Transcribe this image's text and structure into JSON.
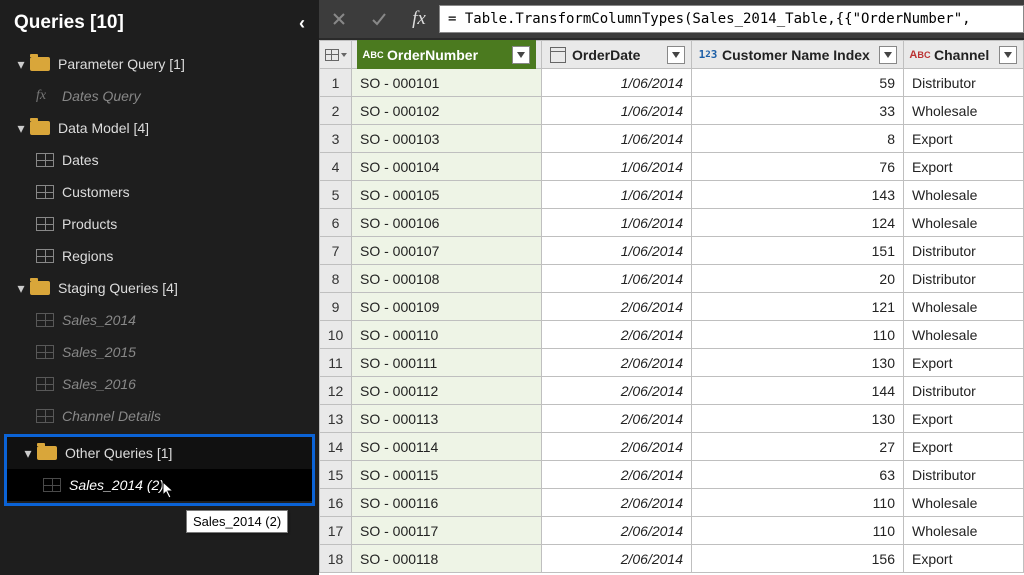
{
  "sidebar": {
    "title": "Queries [10]",
    "groups": [
      {
        "label": "Parameter Query [1]",
        "items": [
          {
            "kind": "fx",
            "label": "Dates Query",
            "dim": true
          }
        ]
      },
      {
        "label": "Data Model [4]",
        "items": [
          {
            "kind": "table",
            "label": "Dates"
          },
          {
            "kind": "table",
            "label": "Customers"
          },
          {
            "kind": "table",
            "label": "Products"
          },
          {
            "kind": "table",
            "label": "Regions"
          }
        ]
      },
      {
        "label": "Staging Queries [4]",
        "items": [
          {
            "kind": "table",
            "label": "Sales_2014",
            "dim": true
          },
          {
            "kind": "table",
            "label": "Sales_2015",
            "dim": true
          },
          {
            "kind": "table",
            "label": "Sales_2016",
            "dim": true
          },
          {
            "kind": "table",
            "label": "Channel Details",
            "dim": true
          }
        ]
      },
      {
        "label": "Other Queries [1]",
        "selected": true,
        "items": [
          {
            "kind": "table",
            "label": "Sales_2014 (2)",
            "dim": true,
            "selected": true
          }
        ]
      }
    ],
    "tooltip": "Sales_2014 (2)"
  },
  "formula": "= Table.TransformColumnTypes(Sales_2014_Table,{{\"OrderNumber\",",
  "columns": [
    {
      "key": "orderNumber",
      "label": "OrderNumber",
      "type": "abc",
      "selected": true
    },
    {
      "key": "orderDate",
      "label": "OrderDate",
      "type": "date"
    },
    {
      "key": "customerIdx",
      "label": "Customer Name Index",
      "type": "num"
    },
    {
      "key": "channel",
      "label": "Channel",
      "type": "abc-dark"
    }
  ],
  "rows": [
    {
      "orderNumber": "SO - 000101",
      "orderDate": "1/06/2014",
      "customerIdx": 59,
      "channel": "Distributor"
    },
    {
      "orderNumber": "SO - 000102",
      "orderDate": "1/06/2014",
      "customerIdx": 33,
      "channel": "Wholesale"
    },
    {
      "orderNumber": "SO - 000103",
      "orderDate": "1/06/2014",
      "customerIdx": 8,
      "channel": "Export"
    },
    {
      "orderNumber": "SO - 000104",
      "orderDate": "1/06/2014",
      "customerIdx": 76,
      "channel": "Export"
    },
    {
      "orderNumber": "SO - 000105",
      "orderDate": "1/06/2014",
      "customerIdx": 143,
      "channel": "Wholesale"
    },
    {
      "orderNumber": "SO - 000106",
      "orderDate": "1/06/2014",
      "customerIdx": 124,
      "channel": "Wholesale"
    },
    {
      "orderNumber": "SO - 000107",
      "orderDate": "1/06/2014",
      "customerIdx": 151,
      "channel": "Distributor"
    },
    {
      "orderNumber": "SO - 000108",
      "orderDate": "1/06/2014",
      "customerIdx": 20,
      "channel": "Distributor"
    },
    {
      "orderNumber": "SO - 000109",
      "orderDate": "2/06/2014",
      "customerIdx": 121,
      "channel": "Wholesale"
    },
    {
      "orderNumber": "SO - 000110",
      "orderDate": "2/06/2014",
      "customerIdx": 110,
      "channel": "Wholesale"
    },
    {
      "orderNumber": "SO - 000111",
      "orderDate": "2/06/2014",
      "customerIdx": 130,
      "channel": "Export"
    },
    {
      "orderNumber": "SO - 000112",
      "orderDate": "2/06/2014",
      "customerIdx": 144,
      "channel": "Distributor"
    },
    {
      "orderNumber": "SO - 000113",
      "orderDate": "2/06/2014",
      "customerIdx": 130,
      "channel": "Export"
    },
    {
      "orderNumber": "SO - 000114",
      "orderDate": "2/06/2014",
      "customerIdx": 27,
      "channel": "Export"
    },
    {
      "orderNumber": "SO - 000115",
      "orderDate": "2/06/2014",
      "customerIdx": 63,
      "channel": "Distributor"
    },
    {
      "orderNumber": "SO - 000116",
      "orderDate": "2/06/2014",
      "customerIdx": 110,
      "channel": "Wholesale"
    },
    {
      "orderNumber": "SO - 000117",
      "orderDate": "2/06/2014",
      "customerIdx": 110,
      "channel": "Wholesale"
    },
    {
      "orderNumber": "SO - 000118",
      "orderDate": "2/06/2014",
      "customerIdx": 156,
      "channel": "Export"
    }
  ]
}
